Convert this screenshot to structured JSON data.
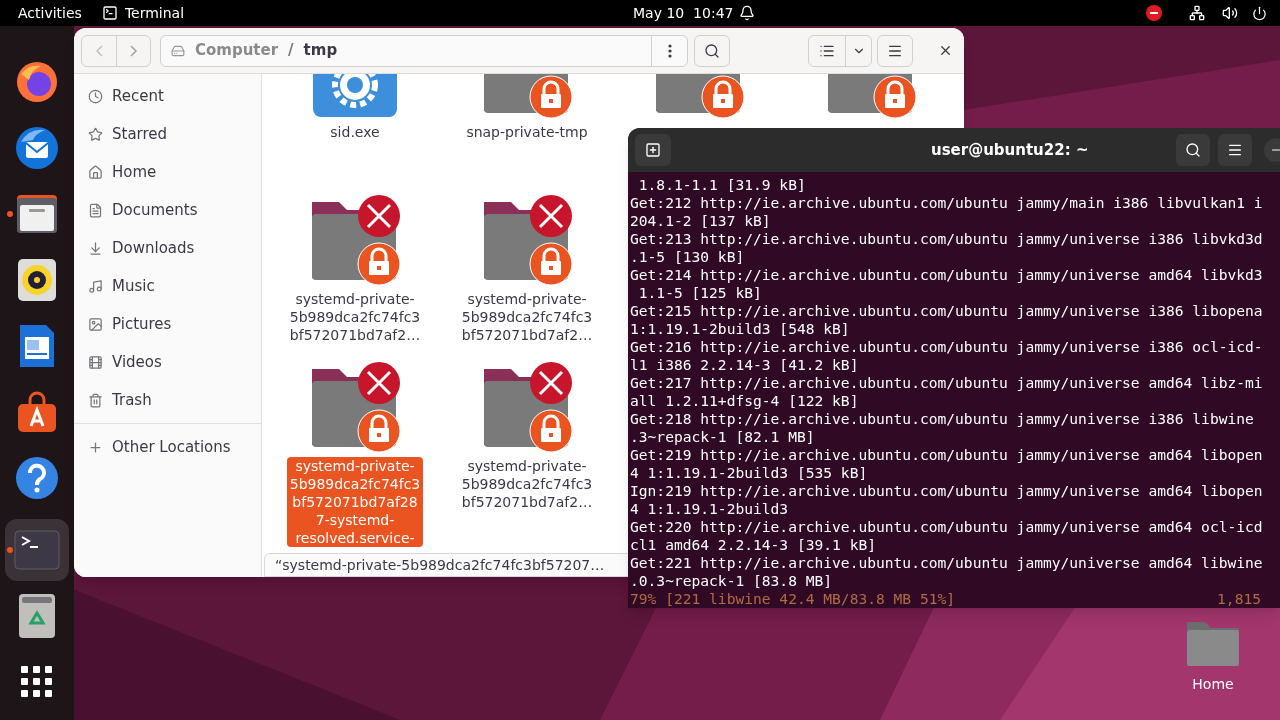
{
  "top_bar": {
    "activities": "Activities",
    "app": "Terminal",
    "clock": "May 10  10:47"
  },
  "dock": [
    {
      "kind": "firefox",
      "running": false,
      "selected": false
    },
    {
      "kind": "thunderbird",
      "running": false,
      "selected": false
    },
    {
      "kind": "files",
      "running": true,
      "selected": false
    },
    {
      "kind": "rhythmbox",
      "running": false,
      "selected": false
    },
    {
      "kind": "writer",
      "running": false,
      "selected": false
    },
    {
      "kind": "appcenter",
      "running": false,
      "selected": false
    },
    {
      "kind": "help",
      "running": false,
      "selected": false
    },
    {
      "kind": "terminal",
      "running": true,
      "selected": true
    },
    {
      "kind": "trash",
      "running": false,
      "selected": false
    },
    {
      "kind": "apps",
      "running": false,
      "selected": false
    }
  ],
  "files": {
    "path": [
      {
        "label": "Computer",
        "current": false
      },
      {
        "label": "tmp",
        "current": true
      }
    ],
    "separator": "/",
    "sidebar": [
      {
        "label": "Recent"
      },
      {
        "label": "Starred"
      },
      {
        "label": "Home"
      },
      {
        "label": "Documents"
      },
      {
        "label": "Downloads"
      },
      {
        "label": "Music"
      },
      {
        "label": "Pictures"
      },
      {
        "label": "Videos"
      },
      {
        "label": "Trash"
      }
    ],
    "other_locations": "Other Locations",
    "rows": [
      [
        {
          "kind": "app",
          "name": "sid.exe",
          "selected": false
        },
        {
          "kind": "locked",
          "name": "snap-private-tmp",
          "selected": false
        },
        {
          "kind": "locked",
          "selected": false
        },
        {
          "kind": "locked",
          "selected": false
        }
      ],
      [
        {
          "kind": "locked-error",
          "name": "systemd-private-5b989dca2fc74fc3bf572071bd7af2…",
          "selected": false
        },
        {
          "kind": "locked-error",
          "name": "systemd-private-5b989dca2fc74fc3bf572071bd7af2…",
          "selected": false
        }
      ],
      [
        {
          "kind": "locked-error",
          "name": "systemd-private-5b989dca2fc74fc3bf572071bd7af287-systemd-resolved.service-",
          "selected": true
        },
        {
          "kind": "locked-error",
          "name": "systemd-private-5b989dca2fc74fc3bf572071bd7af2…",
          "selected": false
        }
      ]
    ],
    "status": "“systemd-private-5b989dca2fc74fc3bf57207…"
  },
  "terminal": {
    "title": "user@ubuntu22: ~",
    "lines": [
      " 1.8.1-1.1 [31.9 kB]",
      "Get:212 http://ie.archive.ubuntu.com/ubuntu jammy/main i386 libvulkan1 i",
      "204.1-2 [137 kB]",
      "Get:213 http://ie.archive.ubuntu.com/ubuntu jammy/universe i386 libvkd3d",
      ".1-5 [130 kB]",
      "Get:214 http://ie.archive.ubuntu.com/ubuntu jammy/universe amd64 libvkd3",
      " 1.1-5 [125 kB]",
      "Get:215 http://ie.archive.ubuntu.com/ubuntu jammy/universe i386 libopena",
      "1:1.19.1-2build3 [548 kB]",
      "Get:216 http://ie.archive.ubuntu.com/ubuntu jammy/universe i386 ocl-icd-",
      "l1 i386 2.2.14-3 [41.2 kB]",
      "Get:217 http://ie.archive.ubuntu.com/ubuntu jammy/universe amd64 libz-mi",
      "all 1.2.11+dfsg-4 [122 kB]",
      "Get:218 http://ie.archive.ubuntu.com/ubuntu jammy/universe i386 libwine",
      ".3~repack-1 [82.1 MB]",
      "Get:219 http://ie.archive.ubuntu.com/ubuntu jammy/universe amd64 libopen",
      "4 1:1.19.1-2build3 [535 kB]",
      "Ign:219 http://ie.archive.ubuntu.com/ubuntu jammy/universe amd64 libopen",
      "4 1:1.19.1-2build3",
      "Get:220 http://ie.archive.ubuntu.com/ubuntu jammy/universe amd64 ocl-icd",
      "cl1 amd64 2.2.14-3 [39.1 kB]",
      "Get:221 http://ie.archive.ubuntu.com/ubuntu jammy/universe amd64 libwine",
      ".0.3~repack-1 [83.8 MB]"
    ],
    "progress": "79% [221 libwine 42.4 MB/83.8 MB 51%]",
    "rate": "1,815"
  },
  "desktop_icons": [
    {
      "label": "Home"
    }
  ]
}
